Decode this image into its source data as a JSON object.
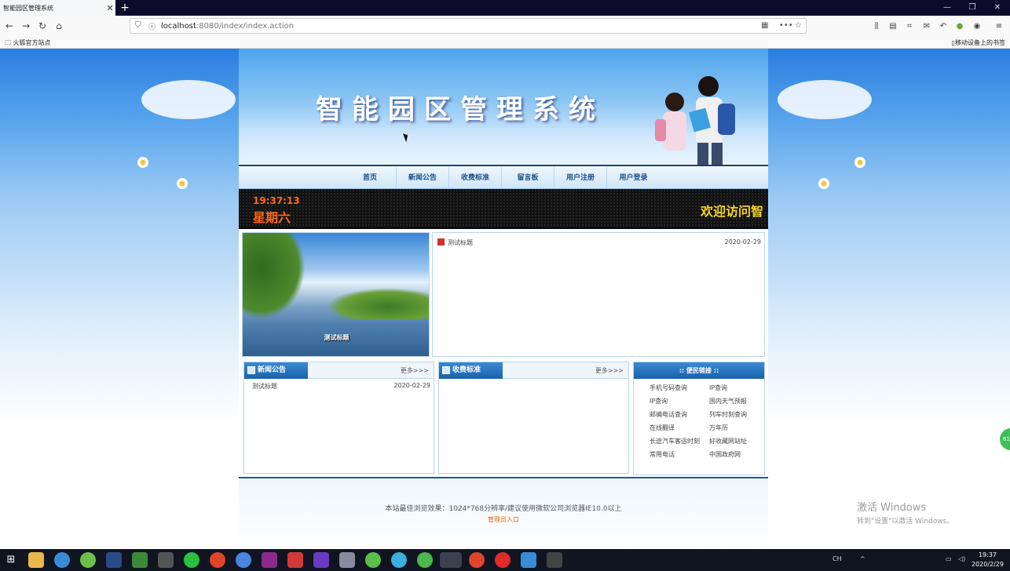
{
  "browser": {
    "tab_title": "智能园区管理系统",
    "tab_close": "✕",
    "new_tab": "+",
    "url_host": "localhost",
    "url_rest": ":8080/index/index.action",
    "bookmark_left": "火狐官方站点",
    "bookmark_right": "移动设备上的书签"
  },
  "page": {
    "banner_title": "智能园区管理系统",
    "menu": [
      "首页",
      "新闻公告",
      "收费标准",
      "留言板",
      "用户注册",
      "用户登录"
    ],
    "led": {
      "time": "19:37:13",
      "day": "星期六",
      "welcome": "欢迎访问智"
    },
    "photo_caption": "测试标题",
    "top_news": {
      "title": "测试标题",
      "date": "2020-02-29"
    },
    "panels": {
      "news": {
        "title": "新闻公告",
        "more": "更多>>>",
        "item_title": "测试标题",
        "item_date": "2020-02-29"
      },
      "fees": {
        "title": "收费标准",
        "more": "更多>>>"
      },
      "links": {
        "title": ":: 便民链接 ::",
        "items": [
          "手机号码查询",
          "IP查询",
          "IP查询",
          "国内天气预报",
          "邮编电话查询",
          "列车时刻查询",
          "在线翻译",
          "万年历",
          "长途汽车客运时刻",
          "好收藏网站址",
          "常用电话",
          "中国政府网"
        ]
      }
    },
    "footer": {
      "text": "本站最佳浏览效果：1024*768分辨率/建议使用微软公司浏览器IE10.0以上",
      "admin": "管理员入口"
    }
  },
  "overlay": {
    "activate_title": "激活 Windows",
    "activate_sub": "转到\"设置\"以激活 Windows。"
  },
  "taskbar": {
    "time": "19:37",
    "date": "2020/2/29"
  },
  "colors": {
    "accent": "#1a62aa",
    "led_orange": "#ff6a1a",
    "led_yellow": "#f5d61e",
    "admin_link": "#e06a00"
  }
}
